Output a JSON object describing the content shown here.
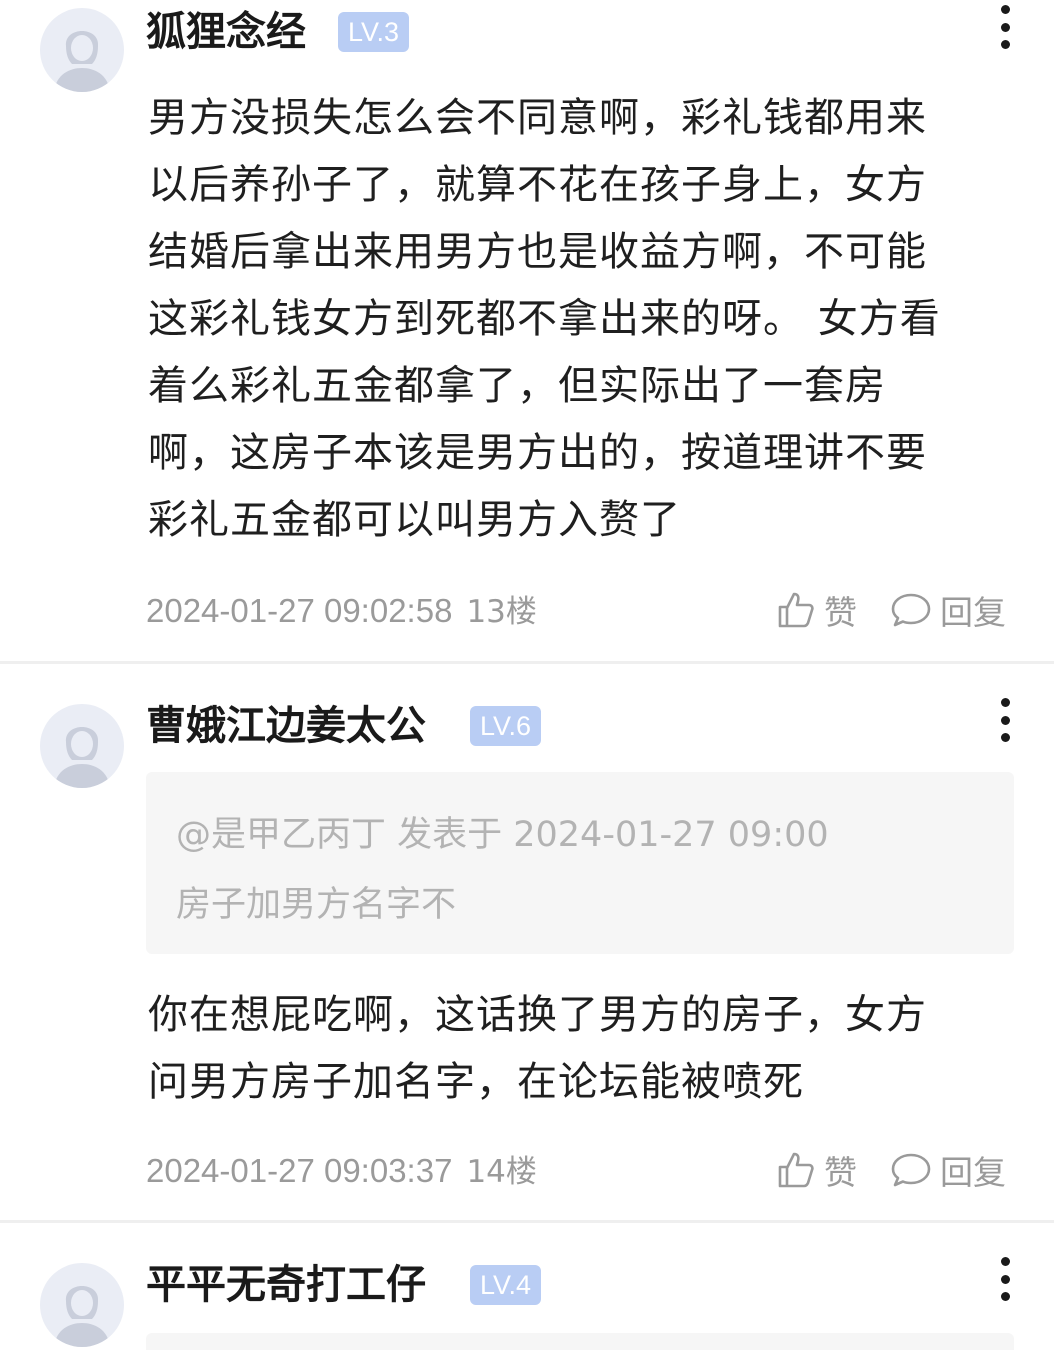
{
  "posts": [
    {
      "username": "狐狸念经",
      "level": "LV.3",
      "content": [
        "男方没损失怎么会不同意啊，彩礼钱都用来",
        "以后养孙子了，就算不花在孩子身上，女方",
        "结婚后拿出来用男方也是收益方啊，不可能",
        "这彩礼钱女方到死都不拿出来的呀。 女方看",
        "着么彩礼五金都拿了，但实际出了一套房",
        "啊，这房子本该是男方出的，按道理讲不要",
        "彩礼五金都可以叫男方入赘了"
      ],
      "timestamp": "2024-01-27 09:02:58",
      "floor": "13楼",
      "like_label": "赞",
      "reply_label": "回复"
    },
    {
      "username": "曹娥江边姜太公",
      "level": "LV.6",
      "quote": {
        "header": "@是甲乙丙丁 发表于 2024-01-27 09:00",
        "text": "房子加男方名字不"
      },
      "content": [
        "你在想屁吃啊，这话换了男方的房子，女方",
        "问男方房子加名字，在论坛能被喷死"
      ],
      "timestamp": "2024-01-27 09:03:37",
      "floor": "14楼",
      "like_label": "赞",
      "reply_label": "回复"
    },
    {
      "username": "平平无奇打工仔",
      "level": "LV.4"
    }
  ],
  "colors": {
    "level_badge": "#b9cdf4",
    "meta_text": "#9a9a9a",
    "quote_bg": "#f6f6f6",
    "avatar_bg": "#eaedf5"
  },
  "icons": [
    "avatar-default-icon",
    "more-vertical-icon",
    "thumbs-up-icon",
    "comment-bubble-icon"
  ]
}
